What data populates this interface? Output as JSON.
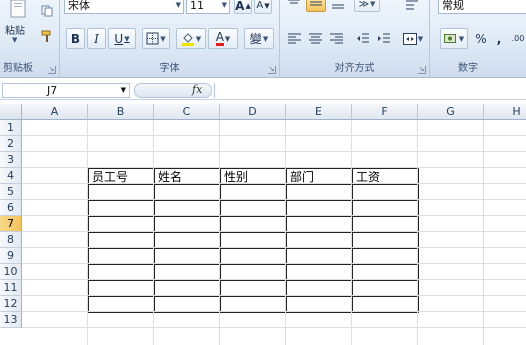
{
  "ribbon": {
    "clipboard": {
      "label": "剪贴板",
      "paste_label": "粘贴"
    },
    "font": {
      "label": "字体",
      "font_name": "宋体",
      "font_size": "11",
      "grow_glyph": "A",
      "shrink_glyph": "A",
      "bold_glyph": "B",
      "italic_glyph": "I",
      "underline_glyph": "U",
      "font_color_glyph": "A",
      "phonetic_glyph": "變"
    },
    "alignment": {
      "label": "对齐方式"
    },
    "number": {
      "label": "数字",
      "format": "常规",
      "percent_glyph": "%",
      "comma_glyph": ","
    }
  },
  "formula_bar": {
    "name_box": "J7",
    "fx": "fx",
    "formula": ""
  },
  "grid": {
    "columns": [
      "A",
      "B",
      "C",
      "D",
      "E",
      "F",
      "G",
      "H"
    ],
    "rows": [
      "1",
      "2",
      "3",
      "4",
      "5",
      "6",
      "7",
      "8",
      "9",
      "10",
      "11",
      "12",
      "13"
    ],
    "active_row": "7"
  },
  "table": {
    "headers": [
      "员工号",
      "姓名",
      "性别",
      "部门",
      "工资"
    ],
    "empty_rows": 8
  },
  "colors": {
    "ribbon_top": "#eef4fb",
    "ribbon_bottom": "#cfdcee",
    "header_bg": "#dfe6ef",
    "active_row_header": "#f3c15a",
    "gridline": "#d9e0ea",
    "table_border": "#222222"
  }
}
